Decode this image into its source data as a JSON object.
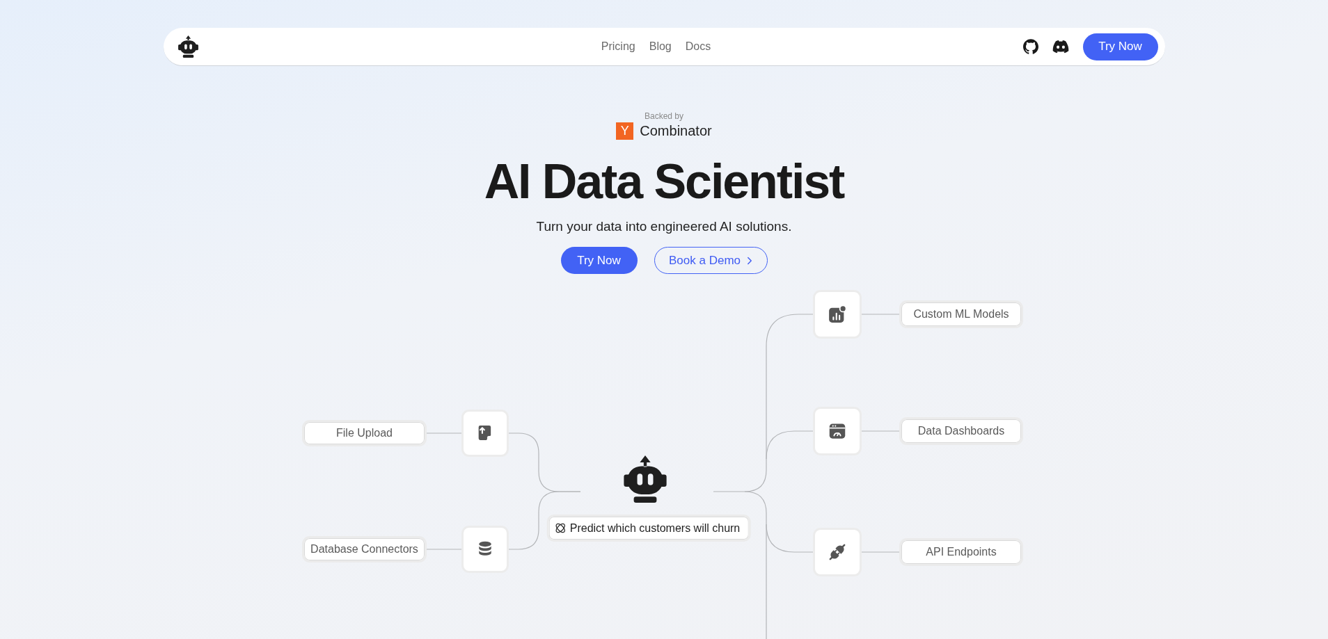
{
  "navbar": {
    "links": [
      {
        "label": "Pricing"
      },
      {
        "label": "Blog"
      },
      {
        "label": "Docs"
      }
    ],
    "cta": "Try Now"
  },
  "hero": {
    "backed_by": "Backed by",
    "backer": {
      "badge": "Y",
      "name": "Combinator"
    },
    "title": "AI Data Scientist",
    "subtitle": "Turn your data into engineered AI solutions.",
    "buttons": [
      {
        "label": "Try Now",
        "kind": "primary"
      },
      {
        "label": "Book a Demo",
        "kind": "outline"
      }
    ]
  },
  "diagram": {
    "inputs": [
      {
        "label": "File Upload"
      },
      {
        "label": "Database Connectors"
      }
    ],
    "prompt": "Predict which customers will churn",
    "outputs": [
      {
        "label": "Custom ML Models"
      },
      {
        "label": "Data Dashboards"
      },
      {
        "label": "API Endpoints"
      }
    ]
  }
}
